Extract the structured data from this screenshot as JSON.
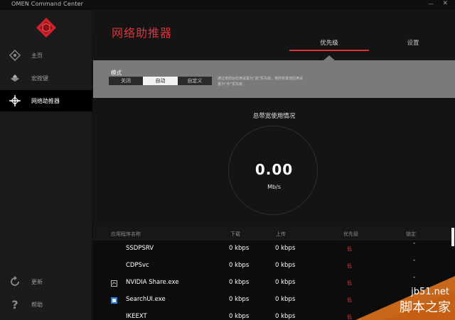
{
  "window": {
    "title": "OMEN Command Center",
    "minimize": "—",
    "close": "✕"
  },
  "sidebar": {
    "items": [
      {
        "label": "主页",
        "icon": "crosshair-icon"
      },
      {
        "label": "宏按键",
        "icon": "macro-key-icon"
      },
      {
        "label": "网络助推器",
        "icon": "network-booster-icon"
      }
    ],
    "footer": [
      {
        "label": "更新",
        "icon": "refresh-icon"
      },
      {
        "label": "帮助",
        "icon": "help-icon"
      }
    ],
    "collapse": "‹"
  },
  "header": {
    "title": "网络助推器",
    "tabs": [
      {
        "label": "优先级"
      },
      {
        "label": "设置"
      }
    ]
  },
  "mode": {
    "label": "模式",
    "options": [
      "关闭",
      "自动",
      "自定义"
    ],
    "selected": "自动",
    "description": "通过将前台应用设置为“高”优先级，将所有其他应用设置为“中”优先级"
  },
  "bandwidth": {
    "title": "总带宽使用情况",
    "value": "0.00",
    "unit": "Mb/s"
  },
  "table": {
    "headers": {
      "name": "应用程序名称",
      "down": "下载",
      "up": "上传",
      "priority": "优先级",
      "lock": "锁定"
    },
    "rows": [
      {
        "name": "SSDPSRV",
        "down": "0 kbps",
        "up": "0 kbps",
        "priority": "低",
        "lock": "-"
      },
      {
        "name": "CDPSvc",
        "down": "0 kbps",
        "up": "0 kbps",
        "priority": "低",
        "lock": "-"
      },
      {
        "name": "NVIDIA Share.exe",
        "down": "0 kbps",
        "up": "0 kbps",
        "priority": "低",
        "lock": "-"
      },
      {
        "name": "SearchUI.exe",
        "down": "0 kbps",
        "up": "0 kbps",
        "priority": "低",
        "lock": "-"
      },
      {
        "name": "IKEEXT",
        "down": "0 kbps",
        "up": "0 kbps",
        "priority": "低",
        "lock": "-"
      }
    ]
  },
  "watermark": {
    "site": "jb51.net",
    "name": "脚本之家"
  },
  "colors": {
    "accent": "#e0323a",
    "panel": "#7a7a7a",
    "sidebar": "#1b1b1b",
    "background": "#141414"
  }
}
